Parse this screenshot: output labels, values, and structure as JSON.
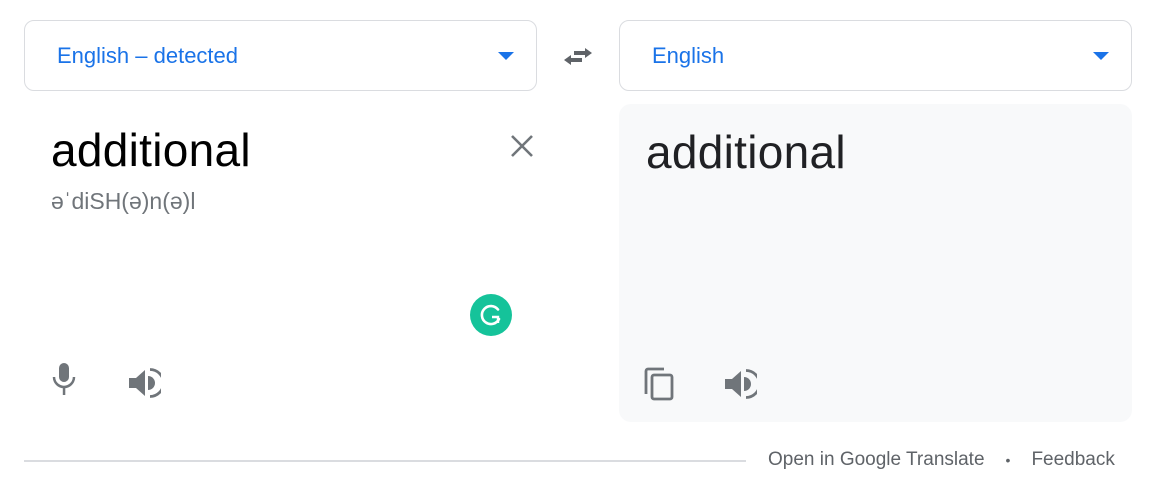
{
  "source_language": {
    "label": "English – detected",
    "icon": "dropdown-arrow-icon"
  },
  "swap": {
    "icon": "swap-arrows-icon"
  },
  "target_language": {
    "label": "English",
    "icon": "dropdown-arrow-icon"
  },
  "source": {
    "text": "additional",
    "phonetic": "əˈdiSH(ə)n(ə)l",
    "icons": {
      "clear": "close-icon",
      "grammarly": "grammarly-icon",
      "mic": "microphone-icon",
      "speaker": "speaker-icon"
    }
  },
  "target": {
    "text": "additional",
    "icons": {
      "copy": "copy-icon",
      "speaker": "speaker-icon"
    }
  },
  "footer": {
    "open_link": "Open in Google Translate",
    "separator": "•",
    "feedback_link": "Feedback"
  },
  "colors": {
    "accent": "#1a73e8",
    "icon_gray": "#70757a",
    "grammarly_green": "#15c39a",
    "panel_bg": "#f8f9fa",
    "border": "#dadce0"
  }
}
